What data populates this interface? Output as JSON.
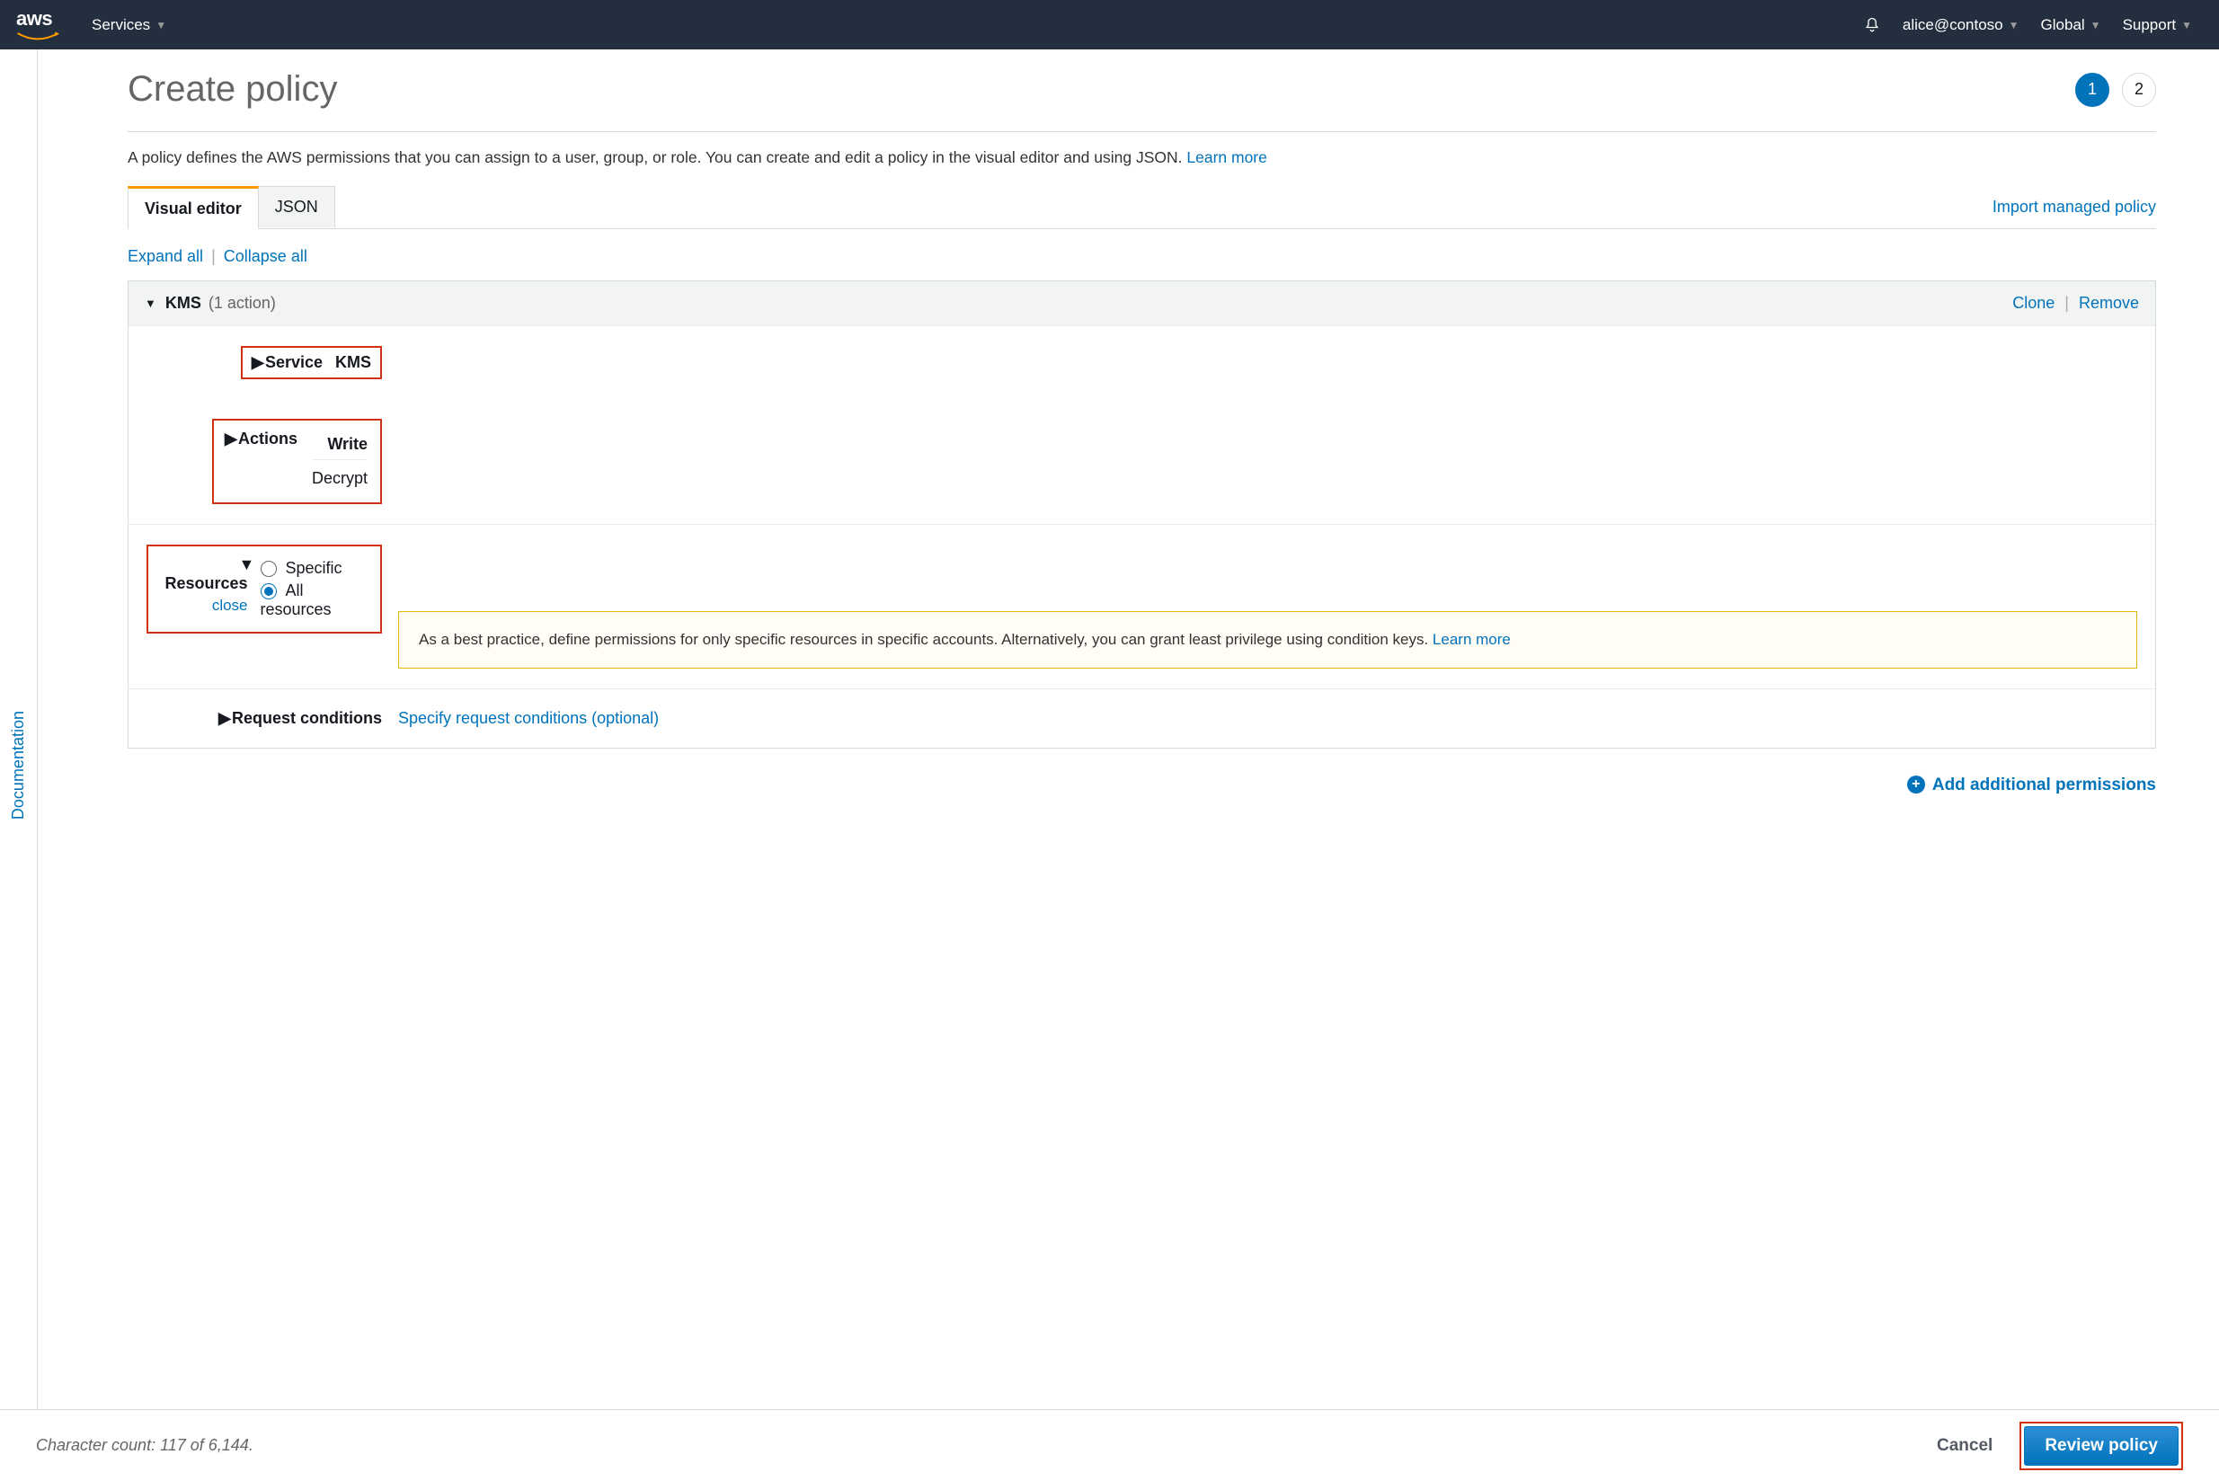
{
  "topnav": {
    "services": "Services",
    "user": "alice@contoso",
    "region": "Global",
    "support": "Support"
  },
  "left_rail": {
    "documentation": "Documentation"
  },
  "page": {
    "title": "Create policy",
    "step_active": 1,
    "step_total": 2,
    "description": "A policy defines the AWS permissions that you can assign to a user, group, or role. You can create and edit a policy in the visual editor and using JSON.",
    "learn_more": "Learn more",
    "tabs": {
      "visual": "Visual editor",
      "json": "JSON"
    },
    "import_link": "Import managed policy",
    "expand_all": "Expand all",
    "collapse_all": "Collapse all",
    "panel": {
      "service_name": "KMS",
      "action_count_label": "(1 action)",
      "clone": "Clone",
      "remove": "Remove",
      "rows": {
        "service": {
          "label": "Service",
          "value": "KMS"
        },
        "actions": {
          "label": "Actions",
          "group": "Write",
          "action": "Decrypt"
        },
        "resources": {
          "label": "Resources",
          "close": "close",
          "specific": "Specific",
          "all": "All resources",
          "notice": "As a best practice, define permissions for only specific resources in specific accounts. Alternatively, you can grant least privilege using condition keys.",
          "notice_link": "Learn more"
        },
        "conditions": {
          "label": "Request conditions",
          "link": "Specify request conditions (optional)"
        }
      }
    },
    "add_permissions": "Add additional permissions"
  },
  "footer": {
    "count_prefix": "Character count: ",
    "count_value": "117 of 6,144.",
    "cancel": "Cancel",
    "review": "Review policy"
  }
}
